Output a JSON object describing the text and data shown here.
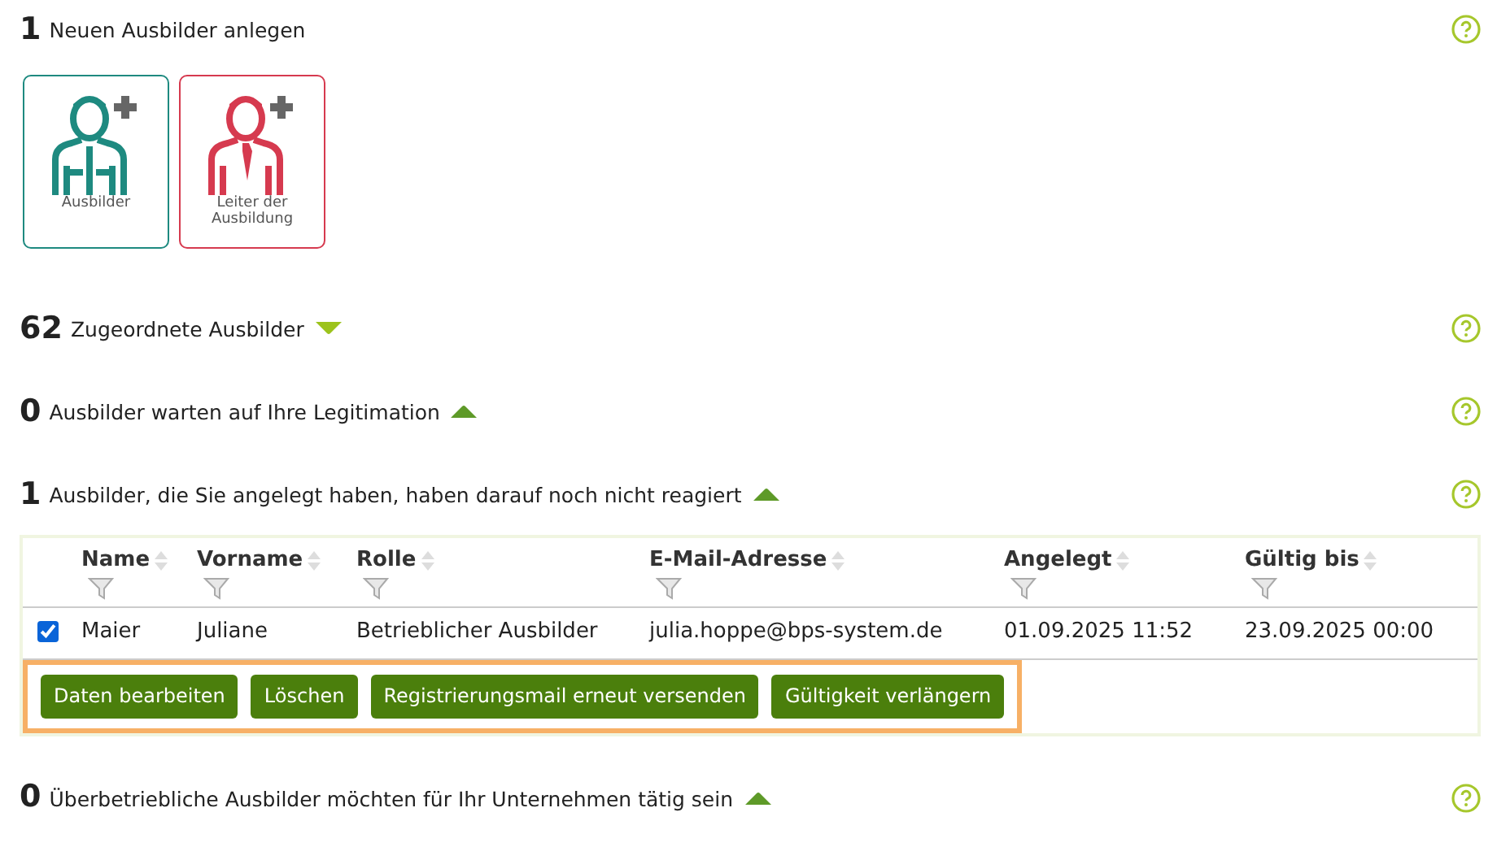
{
  "sections": [
    {
      "kind": "create",
      "count": "1",
      "label": "Neuen Ausbilder anlegen",
      "tiles": [
        {
          "label": "Ausbilder",
          "color": "#1e8a80"
        },
        {
          "label": "Leiter der Ausbildung",
          "color": "#d63a4f"
        }
      ]
    },
    {
      "kind": "list",
      "count": "62",
      "label": "Zugeordnete Ausbilder",
      "expanded": false
    },
    {
      "kind": "list",
      "count": "0",
      "label": "Ausbilder warten auf Ihre Legitimation",
      "expanded": true
    },
    {
      "kind": "list",
      "count": "1",
      "label": "Ausbilder, die Sie angelegt haben, haben darauf noch nicht reagiert",
      "expanded": true,
      "table": {
        "columns": [
          "Name",
          "Vorname",
          "Rolle",
          "E-Mail-Adresse",
          "Angelegt",
          "Gültig bis"
        ],
        "rows": [
          {
            "selected": true,
            "cells": [
              "Maier",
              "Juliane",
              "Betrieblicher Ausbilder",
              "julia.hoppe@bps-system.de",
              "01.09.2025 11:52",
              "23.09.2025 00:00"
            ]
          }
        ],
        "buttons": [
          "Daten bearbeiten",
          "Löschen",
          "Registrierungsmail erneut versenden",
          "Gültigkeit verlängern"
        ]
      }
    },
    {
      "kind": "list",
      "count": "0",
      "label": "Überbetriebliche Ausbilder möchten für Ihr Unternehmen tätig sein",
      "expanded": true
    }
  ]
}
